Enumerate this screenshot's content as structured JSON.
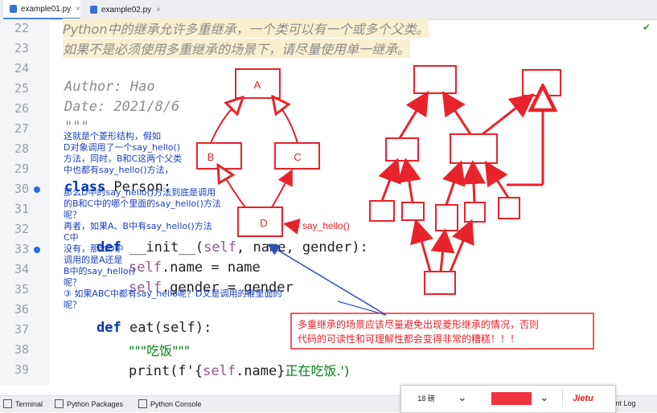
{
  "tabs": [
    {
      "label": "example01.py"
    },
    {
      "label": "example02.py"
    }
  ],
  "code_lines": [
    {
      "num": "22",
      "text": "Python中的继承允许多重继承，一个类可以有一个或多个父类。"
    },
    {
      "num": "23",
      "text": "如果不是必须使用多重继承的场景下，请尽量使用单一继承。"
    },
    {
      "num": "24",
      "text": ""
    },
    {
      "num": "25",
      "text": "Author: Hao"
    },
    {
      "num": "26",
      "text": "Date: 2021/8/6"
    },
    {
      "num": "27",
      "text": "\"\"\""
    },
    {
      "num": "28",
      "text": ""
    },
    {
      "num": "29",
      "text": ""
    },
    {
      "num": "30",
      "kw": "class",
      "rest": " Person:"
    },
    {
      "num": "31",
      "text": ""
    },
    {
      "num": "32",
      "text": ""
    },
    {
      "num": "33",
      "kw": "def",
      "rest_a": " __init__(",
      "self": "self",
      "rest_b": ", name, gender):"
    },
    {
      "num": "34",
      "self": "self",
      "rest": ".name = name"
    },
    {
      "num": "35",
      "self": "self",
      "rest": ".gender = gender"
    },
    {
      "num": "36",
      "text": ""
    },
    {
      "num": "37",
      "kw": "def",
      "rest": " eat(self):"
    },
    {
      "num": "38",
      "doc": "\"\"\"吃饭\"\"\""
    },
    {
      "num": "39",
      "pre": "print(f'{",
      "self": "self",
      "mid": ".name}",
      "str": "正在吃饭.')"
    }
  ],
  "handwritten_note": "这就是个菱形结构，假如\nD对象调用了一个say_hello()\n方法，同时，B和C这两个父类\n中也都有say_hello()方法，\n\n那么D中的say_hello()方法到底是调用\n的B和C中的哪个里面的say_hello()方法\n呢？\n再者，如果A、B中有say_hello()方法\nC中\n没有，那么D中\n调用的是A还是\nB中的say_hello()\n呢？\n③ 如果ABC中都有say_hello呢？D又是调用的谁里面的\n呢？",
  "diamond_nodes": {
    "a": "A",
    "b": "B",
    "c": "C",
    "d": "D"
  },
  "say_hello_label": "say_hello()",
  "warning_text_1": "多重继承的场景应该尽量避免出现菱形继承的情况，否则",
  "warning_text_2": "代码的可读性和可理解性都会变得非常的糟糕！！！",
  "bottom_bar": {
    "terminal": "Terminal",
    "packages": "Python Packages",
    "console": "Python Console",
    "event_log": "Event Log"
  },
  "toolbar": {
    "font_size": "18 磅",
    "logo": "Jietu"
  },
  "colors": {
    "annotation_red": "#e8232b",
    "note_blue": "#1a3fbf"
  }
}
